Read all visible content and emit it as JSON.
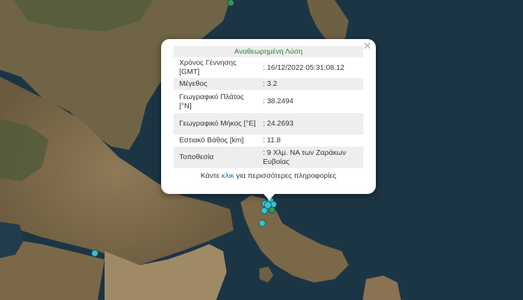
{
  "popup": {
    "close_icon": "close-icon",
    "title": "Αναθεωρημένη Λύση",
    "rows": [
      {
        "key": "Χρόνος Γέννησης [GMT]",
        "value": ": 16/12/2022 05:31:08.12"
      },
      {
        "key": "Μέγεθος",
        "value": ": 3.2"
      },
      {
        "key": "Γεωγραφικό Πλάτος [°N]",
        "value": ": 38.2494"
      },
      {
        "key": "Γεωγραφικό Μήκος [°E]",
        "value": ": 24.2693"
      },
      {
        "key": "Εστιακό Βάθος [km]",
        "value": ": 11.8"
      },
      {
        "key": "Τοποθεσία",
        "value": ": 9 Χλμ. ΝΑ των Ζαράκων Ευβοίας"
      }
    ],
    "footer_prefix": "Κάντε",
    "footer_link": "κλικ",
    "footer_suffix": "για περισσότερες πληροφορίες"
  },
  "colors": {
    "sea": "#1c3544",
    "land": "#7d6a4c",
    "marker_cyan": "#36c3cf",
    "marker_green": "#2f9a5c",
    "title_green": "#2a8a2a",
    "link": "#1a6fb0"
  }
}
